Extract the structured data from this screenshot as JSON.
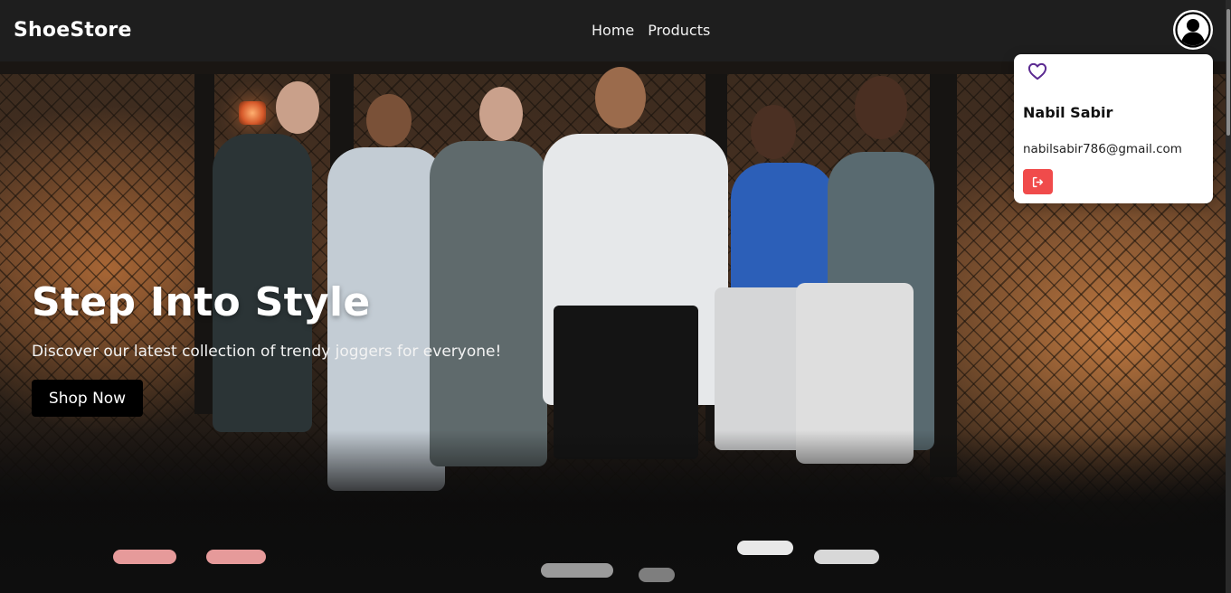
{
  "navbar": {
    "brand": "ShoeStore",
    "links": [
      {
        "label": "Home"
      },
      {
        "label": "Products"
      }
    ],
    "avatar_icon": "user-circle-icon"
  },
  "hero": {
    "title": "Step Into Style",
    "subtitle": "Discover our latest collection of trendy joggers for everyone!",
    "cta_label": "Shop Now"
  },
  "profile_menu": {
    "wishlist_icon": "heart-icon",
    "name": "Nabil Sabir",
    "email": "nabilsabir786@gmail.com",
    "logout_icon": "logout-icon",
    "wishlist_color": "#5b2a91",
    "logout_color": "#f04b4b"
  }
}
